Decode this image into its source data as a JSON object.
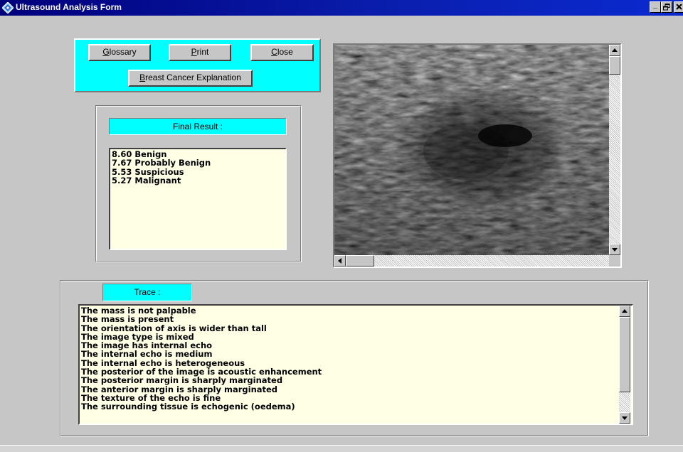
{
  "window": {
    "title": "Ultrasound Analysis Form",
    "controls": {
      "minimize": "_",
      "maximize": "🗗",
      "close": "×"
    }
  },
  "toolbar": {
    "glossary": {
      "mnemonic": "G",
      "rest": "lossary"
    },
    "print": {
      "mnemonic": "P",
      "rest": "rint"
    },
    "close": {
      "mnemonic": "C",
      "rest": "lose"
    },
    "explanation": {
      "mnemonic": "B",
      "rest": "reast Cancer Explanation"
    }
  },
  "final_result": {
    "label": "Final Result :",
    "items": [
      "8.60 Benign",
      "7.67 Probably Benign",
      "5.53 Suspicious",
      "5.27 Malignant"
    ]
  },
  "trace": {
    "label": "Trace :",
    "items": [
      "The mass is not palpable",
      "The mass is present",
      "The orientation of axis is wider than tall",
      "The image type is mixed",
      "The image has internal echo",
      "The internal echo is medium",
      "The internal echo is heterogeneous",
      "The posterior of the image is acoustic enhancement",
      "The posterior margin is sharply marginated",
      "The anterior margin is sharply marginated",
      "The texture of the echo is fine",
      "The surrounding tissue is echogenic (oedema)"
    ]
  },
  "colors": {
    "titlebar": "#0a1fb0",
    "panel_accent": "#00ffff",
    "listbox_bg": "#ffffe6",
    "window_bg": "#c6c6c6"
  },
  "icons": {
    "app": "diamond-app-icon",
    "scroll_up": "arrow-up-icon",
    "scroll_down": "arrow-down-icon",
    "scroll_left": "arrow-left-icon",
    "scroll_right": "arrow-right-icon"
  }
}
